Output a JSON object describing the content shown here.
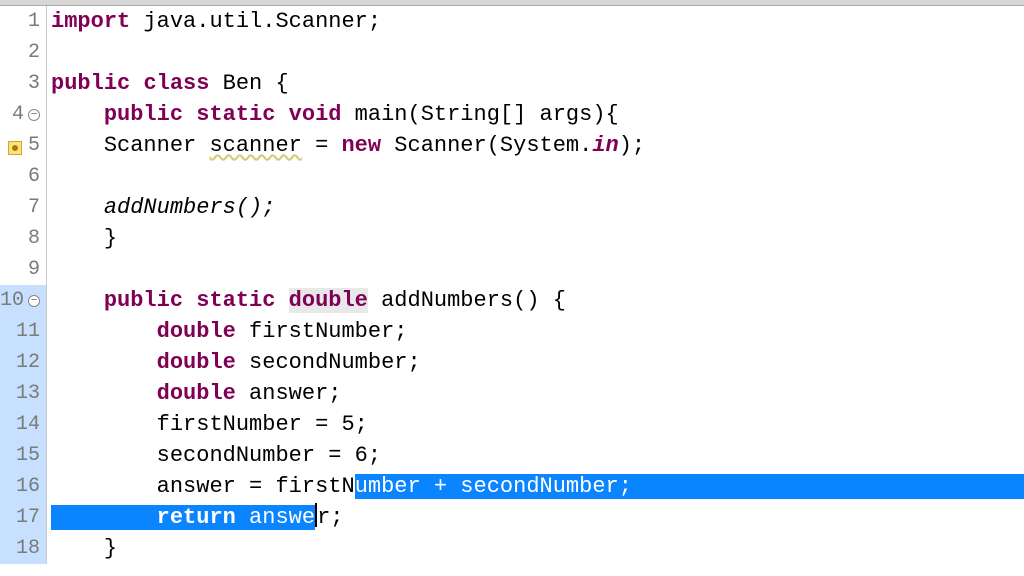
{
  "lines": [
    {
      "num": "1",
      "fold": false,
      "warn": false
    },
    {
      "num": "2",
      "fold": false,
      "warn": false
    },
    {
      "num": "3",
      "fold": false,
      "warn": false
    },
    {
      "num": "4",
      "fold": true,
      "warn": false
    },
    {
      "num": "5",
      "fold": false,
      "warn": true
    },
    {
      "num": "6",
      "fold": false,
      "warn": false
    },
    {
      "num": "7",
      "fold": false,
      "warn": false
    },
    {
      "num": "8",
      "fold": false,
      "warn": false
    },
    {
      "num": "9",
      "fold": false,
      "warn": false
    },
    {
      "num": "10",
      "fold": true,
      "warn": false
    },
    {
      "num": "11",
      "fold": false,
      "warn": false
    },
    {
      "num": "12",
      "fold": false,
      "warn": false
    },
    {
      "num": "13",
      "fold": false,
      "warn": false
    },
    {
      "num": "14",
      "fold": false,
      "warn": false
    },
    {
      "num": "15",
      "fold": false,
      "warn": false
    },
    {
      "num": "16",
      "fold": false,
      "warn": false
    },
    {
      "num": "17",
      "fold": false,
      "warn": false
    },
    {
      "num": "18",
      "fold": false,
      "warn": false
    }
  ],
  "code": {
    "l1": {
      "kw1": "import",
      "rest": " java.util.Scanner;"
    },
    "l3": {
      "kw1": "public",
      "kw2": "class",
      "name": " Ben {"
    },
    "l4": {
      "indent": "    ",
      "kw1": "public",
      "kw2": "static",
      "kw3": "void",
      "name": " main(String[] args){"
    },
    "l5": {
      "indent": "    ",
      "t1": "Scanner ",
      "scanner": "scanner",
      "eq": " = ",
      "kw": "new",
      "t2": " Scanner(System.",
      "in": "in",
      "t3": ");"
    },
    "l7": {
      "indent": "    ",
      "call": "addNumbers();"
    },
    "l8": {
      "indent": "    ",
      "brace": "}"
    },
    "l10": {
      "indent": "    ",
      "kw1": "public",
      "kw2": "static",
      "kw3": "double",
      "name": " addNumbers() {"
    },
    "l11": {
      "indent": "        ",
      "kw": "double",
      "rest": " firstNumber;"
    },
    "l12": {
      "indent": "        ",
      "kw": "double",
      "rest": " secondNumber;"
    },
    "l13": {
      "indent": "        ",
      "kw": "double",
      "rest": " answer;"
    },
    "l14": {
      "indent": "        ",
      "rest": "firstNumber = 5;"
    },
    "l15": {
      "indent": "        ",
      "rest": "secondNumber = 6;"
    },
    "l16": {
      "indent": "        ",
      "pre": "answer = firstN",
      "sel": "umber + secondNumber;"
    },
    "l17": {
      "indent": "        ",
      "kw": "return",
      "mid": " answe",
      "after": "r;",
      "selpad": "                                              "
    },
    "l18": {
      "indent": "    ",
      "brace": "}"
    }
  },
  "fold_glyph": "−",
  "highlight_gutter_start": 10,
  "highlight_gutter_end": 18
}
